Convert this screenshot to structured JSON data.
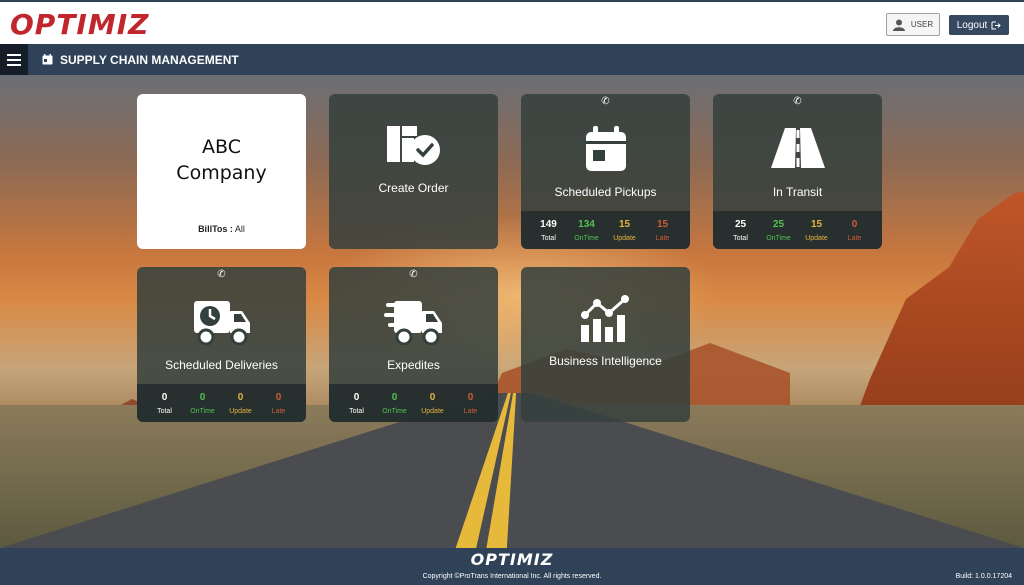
{
  "header": {
    "logo_text": "OPTIMIZ",
    "user_label": "USER",
    "logout_label": "Logout"
  },
  "nav": {
    "title": "SUPPLY CHAIN MANAGEMENT"
  },
  "company": {
    "name_line1": "ABC",
    "name_line2": "Company",
    "billtos_label": "BillTos :",
    "billtos_value": "All"
  },
  "tiles": {
    "create_order": {
      "label": "Create Order"
    },
    "scheduled_pickups": {
      "label": "Scheduled Pickups",
      "total": "149",
      "ontime": "134",
      "update": "15",
      "late": "15"
    },
    "in_transit": {
      "label": "In Transit",
      "total": "25",
      "ontime": "25",
      "update": "15",
      "late": "0"
    },
    "scheduled_deliveries": {
      "label": "Scheduled Deliveries",
      "total": "0",
      "ontime": "0",
      "update": "0",
      "late": "0"
    },
    "expedites": {
      "label": "Expedites",
      "total": "0",
      "ontime": "0",
      "update": "0",
      "late": "0"
    },
    "business_intelligence": {
      "label": "Business Intelligence"
    }
  },
  "count_labels": {
    "total": "Total",
    "ontime": "OnTime",
    "update": "Update",
    "late": "Late"
  },
  "footer": {
    "logo_text": "OPTIMIZ",
    "copyright": "Copyright ©ProTrans International Inc. All rights reserved.",
    "build": "Build: 1.0.0.17204"
  },
  "colors": {
    "brand_red": "#c0262c",
    "navy": "#2f4257",
    "ontime": "#54c054",
    "update": "#e5b43d",
    "late": "#d05a3a"
  }
}
